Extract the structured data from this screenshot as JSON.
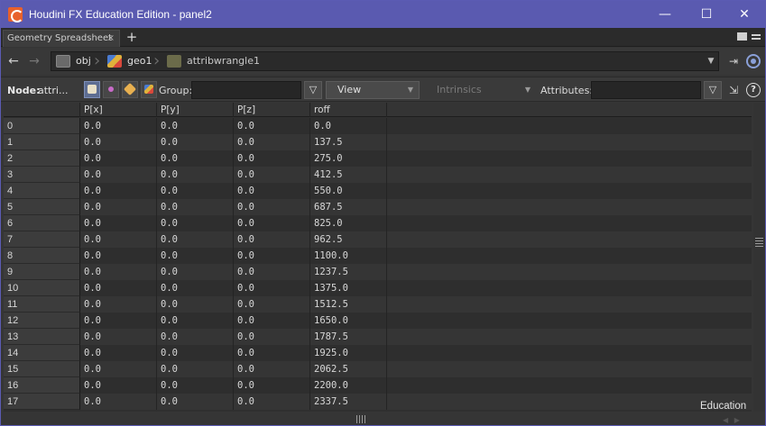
{
  "window": {
    "title": "Houdini FX Education Edition - panel2",
    "minimize": "—",
    "maximize": "☐",
    "close": "✕"
  },
  "tabs": [
    {
      "label": "Geometry Spreadsheet",
      "close": "×"
    }
  ],
  "tab_add": "+",
  "nav": {
    "back": "←",
    "forward": "→",
    "path": [
      {
        "label": "obj",
        "icon": "obj-network-icon"
      },
      {
        "label": "geo1",
        "icon": "geo-node-icon"
      },
      {
        "label": "attribwrangle1",
        "icon": "wrangle-node-icon"
      }
    ],
    "dropdown": "▼",
    "pin": "⇥"
  },
  "toolbar": {
    "node_label": "Node:",
    "node_value": "attri...",
    "group_label": "Group:",
    "group_value": "",
    "view_combo": "View",
    "intrinsics_combo": "Intrinsics",
    "attributes_label": "Attributes:",
    "attributes_value": "",
    "funnel": "▽",
    "help": "?"
  },
  "spreadsheet": {
    "columns": [
      "",
      "P[x]",
      "P[y]",
      "P[z]",
      "roff"
    ],
    "rows": [
      [
        "0",
        "0.0",
        "0.0",
        "0.0",
        "0.0"
      ],
      [
        "1",
        "0.0",
        "0.0",
        "0.0",
        "137.5"
      ],
      [
        "2",
        "0.0",
        "0.0",
        "0.0",
        "275.0"
      ],
      [
        "3",
        "0.0",
        "0.0",
        "0.0",
        "412.5"
      ],
      [
        "4",
        "0.0",
        "0.0",
        "0.0",
        "550.0"
      ],
      [
        "5",
        "0.0",
        "0.0",
        "0.0",
        "687.5"
      ],
      [
        "6",
        "0.0",
        "0.0",
        "0.0",
        "825.0"
      ],
      [
        "7",
        "0.0",
        "0.0",
        "0.0",
        "962.5"
      ],
      [
        "8",
        "0.0",
        "0.0",
        "0.0",
        "1100.0"
      ],
      [
        "9",
        "0.0",
        "0.0",
        "0.0",
        "1237.5"
      ],
      [
        "10",
        "0.0",
        "0.0",
        "0.0",
        "1375.0"
      ],
      [
        "11",
        "0.0",
        "0.0",
        "0.0",
        "1512.5"
      ],
      [
        "12",
        "0.0",
        "0.0",
        "0.0",
        "1650.0"
      ],
      [
        "13",
        "0.0",
        "0.0",
        "0.0",
        "1787.5"
      ],
      [
        "14",
        "0.0",
        "0.0",
        "0.0",
        "1925.0"
      ],
      [
        "15",
        "0.0",
        "0.0",
        "0.0",
        "2062.5"
      ],
      [
        "16",
        "0.0",
        "0.0",
        "0.0",
        "2200.0"
      ],
      [
        "17",
        "0.0",
        "0.0",
        "0.0",
        "2337.5"
      ]
    ]
  },
  "footer": {
    "edition": "Education"
  },
  "colors": {
    "titlebar": "#5a5ab0",
    "app_icon": "#e8612c",
    "active_class_button": "#5d6d92"
  }
}
